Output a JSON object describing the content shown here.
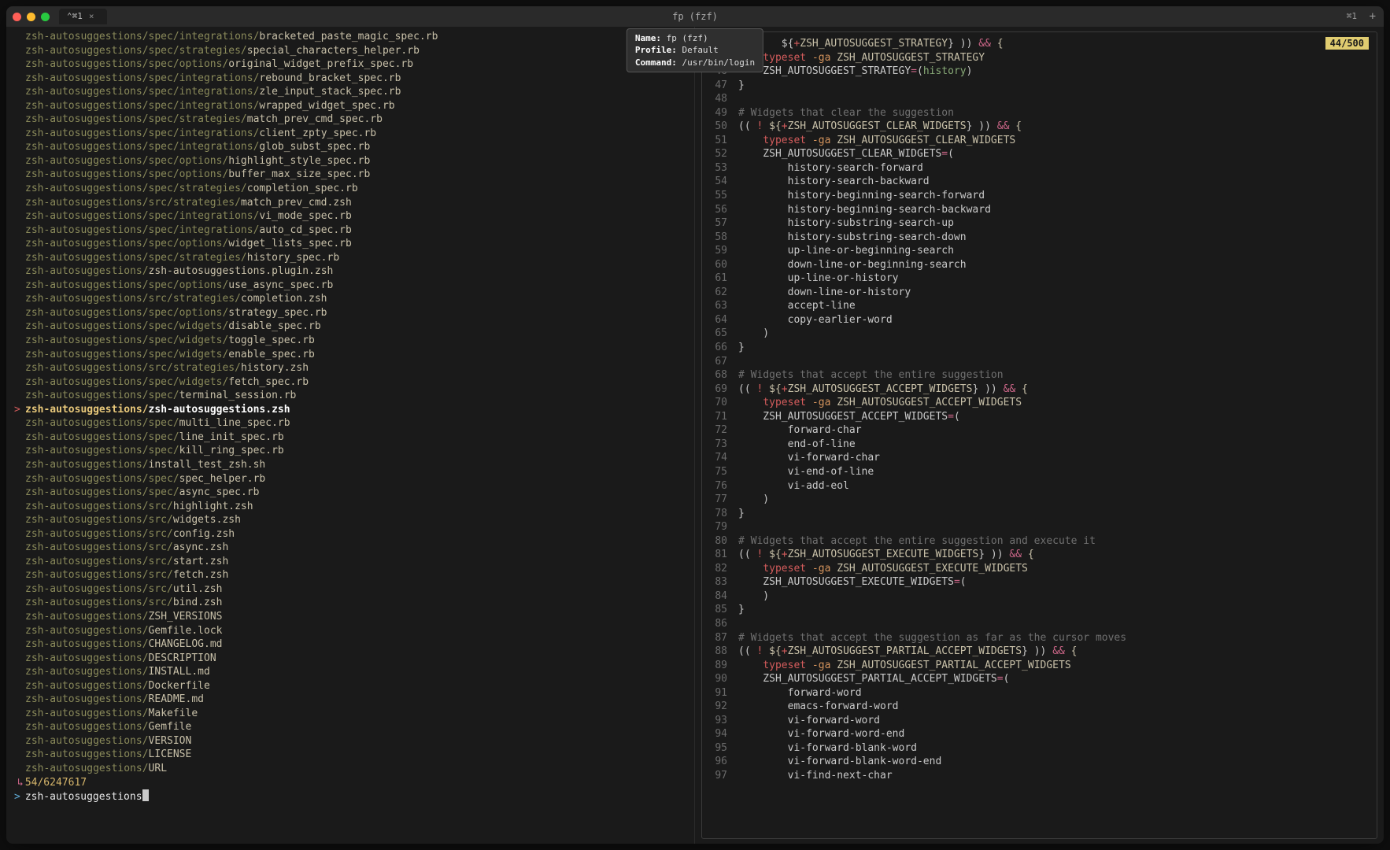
{
  "titlebar": {
    "tab_label": "⌃⌘1",
    "center_title": "fp (fzf)",
    "right_shortcut": "⌘1"
  },
  "tooltip": {
    "name_label": "Name:",
    "name_value": "fp (fzf)",
    "profile_label": "Profile:",
    "profile_value": "Default",
    "command_label": "Command:",
    "command_value": "/usr/bin/login"
  },
  "left_pane": {
    "files": [
      {
        "dir": "zsh-autosuggestions/spec/integrations/",
        "file": "bracketed_paste_magic_spec.rb"
      },
      {
        "dir": "zsh-autosuggestions/spec/strategies/",
        "file": "special_characters_helper.rb"
      },
      {
        "dir": "zsh-autosuggestions/spec/options/",
        "file": "original_widget_prefix_spec.rb"
      },
      {
        "dir": "zsh-autosuggestions/spec/integrations/",
        "file": "rebound_bracket_spec.rb"
      },
      {
        "dir": "zsh-autosuggestions/spec/integrations/",
        "file": "zle_input_stack_spec.rb"
      },
      {
        "dir": "zsh-autosuggestions/spec/integrations/",
        "file": "wrapped_widget_spec.rb"
      },
      {
        "dir": "zsh-autosuggestions/spec/strategies/",
        "file": "match_prev_cmd_spec.rb"
      },
      {
        "dir": "zsh-autosuggestions/spec/integrations/",
        "file": "client_zpty_spec.rb"
      },
      {
        "dir": "zsh-autosuggestions/spec/integrations/",
        "file": "glob_subst_spec.rb"
      },
      {
        "dir": "zsh-autosuggestions/spec/options/",
        "file": "highlight_style_spec.rb"
      },
      {
        "dir": "zsh-autosuggestions/spec/options/",
        "file": "buffer_max_size_spec.rb"
      },
      {
        "dir": "zsh-autosuggestions/spec/strategies/",
        "file": "completion_spec.rb"
      },
      {
        "dir": "zsh-autosuggestions/src/strategies/",
        "file": "match_prev_cmd.zsh"
      },
      {
        "dir": "zsh-autosuggestions/spec/integrations/",
        "file": "vi_mode_spec.rb"
      },
      {
        "dir": "zsh-autosuggestions/spec/integrations/",
        "file": "auto_cd_spec.rb"
      },
      {
        "dir": "zsh-autosuggestions/spec/options/",
        "file": "widget_lists_spec.rb"
      },
      {
        "dir": "zsh-autosuggestions/spec/strategies/",
        "file": "history_spec.rb"
      },
      {
        "dir": "zsh-autosuggestions/",
        "file": "zsh-autosuggestions.plugin.zsh"
      },
      {
        "dir": "zsh-autosuggestions/spec/options/",
        "file": "use_async_spec.rb"
      },
      {
        "dir": "zsh-autosuggestions/src/strategies/",
        "file": "completion.zsh"
      },
      {
        "dir": "zsh-autosuggestions/spec/options/",
        "file": "strategy_spec.rb"
      },
      {
        "dir": "zsh-autosuggestions/spec/widgets/",
        "file": "disable_spec.rb"
      },
      {
        "dir": "zsh-autosuggestions/spec/widgets/",
        "file": "toggle_spec.rb"
      },
      {
        "dir": "zsh-autosuggestions/spec/widgets/",
        "file": "enable_spec.rb"
      },
      {
        "dir": "zsh-autosuggestions/src/strategies/",
        "file": "history.zsh"
      },
      {
        "dir": "zsh-autosuggestions/spec/widgets/",
        "file": "fetch_spec.rb"
      },
      {
        "dir": "zsh-autosuggestions/spec/",
        "file": "terminal_session.rb"
      },
      {
        "dir": "zsh-autosuggestions/",
        "file": "zsh-autosuggestions.zsh",
        "selected": true
      },
      {
        "dir": "zsh-autosuggestions/spec/",
        "file": "multi_line_spec.rb"
      },
      {
        "dir": "zsh-autosuggestions/spec/",
        "file": "line_init_spec.rb"
      },
      {
        "dir": "zsh-autosuggestions/spec/",
        "file": "kill_ring_spec.rb"
      },
      {
        "dir": "zsh-autosuggestions/",
        "file": "install_test_zsh.sh"
      },
      {
        "dir": "zsh-autosuggestions/spec/",
        "file": "spec_helper.rb"
      },
      {
        "dir": "zsh-autosuggestions/spec/",
        "file": "async_spec.rb"
      },
      {
        "dir": "zsh-autosuggestions/src/",
        "file": "highlight.zsh"
      },
      {
        "dir": "zsh-autosuggestions/src/",
        "file": "widgets.zsh"
      },
      {
        "dir": "zsh-autosuggestions/src/",
        "file": "config.zsh"
      },
      {
        "dir": "zsh-autosuggestions/src/",
        "file": "async.zsh"
      },
      {
        "dir": "zsh-autosuggestions/src/",
        "file": "start.zsh"
      },
      {
        "dir": "zsh-autosuggestions/src/",
        "file": "fetch.zsh"
      },
      {
        "dir": "zsh-autosuggestions/src/",
        "file": "util.zsh"
      },
      {
        "dir": "zsh-autosuggestions/src/",
        "file": "bind.zsh"
      },
      {
        "dir": "zsh-autosuggestions/",
        "file": "ZSH_VERSIONS"
      },
      {
        "dir": "zsh-autosuggestions/",
        "file": "Gemfile.lock"
      },
      {
        "dir": "zsh-autosuggestions/",
        "file": "CHANGELOG.md"
      },
      {
        "dir": "zsh-autosuggestions/",
        "file": "DESCRIPTION"
      },
      {
        "dir": "zsh-autosuggestions/",
        "file": "INSTALL.md"
      },
      {
        "dir": "zsh-autosuggestions/",
        "file": "Dockerfile"
      },
      {
        "dir": "zsh-autosuggestions/",
        "file": "README.md"
      },
      {
        "dir": "zsh-autosuggestions/",
        "file": "Makefile"
      },
      {
        "dir": "zsh-autosuggestions/",
        "file": "Gemfile"
      },
      {
        "dir": "zsh-autosuggestions/",
        "file": "VERSION"
      },
      {
        "dir": "zsh-autosuggestions/",
        "file": "LICENSE"
      },
      {
        "dir": "zsh-autosuggestions/",
        "file": "URL"
      }
    ],
    "stats": "54/6247617",
    "query": "zsh-autosuggestions"
  },
  "right_pane": {
    "badge": "44/500",
    "code": [
      {
        "n": "",
        "segs": [
          [
            "",
            "       ${"
          ],
          [
            "plus",
            "+"
          ],
          [
            "var",
            "ZSH_AUTOSUGGEST_STRATEGY"
          ],
          [
            "",
            "} )) "
          ],
          [
            "op",
            "&&"
          ],
          [
            "var",
            " {"
          ]
        ]
      },
      {
        "n": 45,
        "segs": [
          [
            "",
            "    "
          ],
          [
            "kw",
            "typeset"
          ],
          [
            "str",
            " -ga"
          ],
          [
            "var",
            " ZSH_AUTOSUGGEST_STRATEGY"
          ]
        ]
      },
      {
        "n": 46,
        "segs": [
          [
            "",
            "    ZSH_AUTOSUGGEST_STRATEGY"
          ],
          [
            "op",
            "="
          ],
          [
            "",
            "("
          ],
          [
            "fn",
            "history"
          ],
          [
            "",
            ")"
          ]
        ]
      },
      {
        "n": 47,
        "segs": [
          [
            "",
            "}"
          ]
        ]
      },
      {
        "n": 48,
        "segs": [
          [
            "",
            " "
          ]
        ]
      },
      {
        "n": 49,
        "segs": [
          [
            "comment",
            "# Widgets that clear the suggestion"
          ]
        ]
      },
      {
        "n": 50,
        "segs": [
          [
            "",
            "(( "
          ],
          [
            "kw",
            "!"
          ],
          [
            "var",
            " ${"
          ],
          [
            "plus",
            "+"
          ],
          [
            "var",
            "ZSH_AUTOSUGGEST_CLEAR_WIDGETS"
          ],
          [
            "",
            "} )) "
          ],
          [
            "op",
            "&&"
          ],
          [
            "var",
            " {"
          ]
        ]
      },
      {
        "n": 51,
        "segs": [
          [
            "",
            "    "
          ],
          [
            "kw",
            "typeset"
          ],
          [
            "str",
            " -ga"
          ],
          [
            "var",
            " ZSH_AUTOSUGGEST_CLEAR_WIDGETS"
          ]
        ]
      },
      {
        "n": 52,
        "segs": [
          [
            "",
            "    ZSH_AUTOSUGGEST_CLEAR_WIDGETS"
          ],
          [
            "op",
            "="
          ],
          [
            "",
            "("
          ]
        ]
      },
      {
        "n": 53,
        "segs": [
          [
            "",
            "        history-search-forward"
          ]
        ]
      },
      {
        "n": 54,
        "segs": [
          [
            "",
            "        history-search-backward"
          ]
        ]
      },
      {
        "n": 55,
        "segs": [
          [
            "",
            "        history-beginning-search-forward"
          ]
        ]
      },
      {
        "n": 56,
        "segs": [
          [
            "",
            "        history-beginning-search-backward"
          ]
        ]
      },
      {
        "n": 57,
        "segs": [
          [
            "",
            "        history-substring-search-up"
          ]
        ]
      },
      {
        "n": 58,
        "segs": [
          [
            "",
            "        history-substring-search-down"
          ]
        ]
      },
      {
        "n": 59,
        "segs": [
          [
            "",
            "        up-line-or-beginning-search"
          ]
        ]
      },
      {
        "n": 60,
        "segs": [
          [
            "",
            "        down-line-or-beginning-search"
          ]
        ]
      },
      {
        "n": 61,
        "segs": [
          [
            "",
            "        up-line-or-history"
          ]
        ]
      },
      {
        "n": 62,
        "segs": [
          [
            "",
            "        down-line-or-history"
          ]
        ]
      },
      {
        "n": 63,
        "segs": [
          [
            "",
            "        accept-line"
          ]
        ]
      },
      {
        "n": 64,
        "segs": [
          [
            "",
            "        copy-earlier-word"
          ]
        ]
      },
      {
        "n": 65,
        "segs": [
          [
            "",
            "    )"
          ]
        ]
      },
      {
        "n": 66,
        "segs": [
          [
            "",
            "}"
          ]
        ]
      },
      {
        "n": 67,
        "segs": [
          [
            "",
            " "
          ]
        ]
      },
      {
        "n": 68,
        "segs": [
          [
            "comment",
            "# Widgets that accept the entire suggestion"
          ]
        ]
      },
      {
        "n": 69,
        "segs": [
          [
            "",
            "(( "
          ],
          [
            "kw",
            "!"
          ],
          [
            "var",
            " ${"
          ],
          [
            "plus",
            "+"
          ],
          [
            "var",
            "ZSH_AUTOSUGGEST_ACCEPT_WIDGETS"
          ],
          [
            "",
            "} )) "
          ],
          [
            "op",
            "&&"
          ],
          [
            "var",
            " {"
          ]
        ]
      },
      {
        "n": 70,
        "segs": [
          [
            "",
            "    "
          ],
          [
            "kw",
            "typeset"
          ],
          [
            "str",
            " -ga"
          ],
          [
            "var",
            " ZSH_AUTOSUGGEST_ACCEPT_WIDGETS"
          ]
        ]
      },
      {
        "n": 71,
        "segs": [
          [
            "",
            "    ZSH_AUTOSUGGEST_ACCEPT_WIDGETS"
          ],
          [
            "op",
            "="
          ],
          [
            "",
            "("
          ]
        ]
      },
      {
        "n": 72,
        "segs": [
          [
            "",
            "        forward-char"
          ]
        ]
      },
      {
        "n": 73,
        "segs": [
          [
            "",
            "        end-of-line"
          ]
        ]
      },
      {
        "n": 74,
        "segs": [
          [
            "",
            "        vi-forward-char"
          ]
        ]
      },
      {
        "n": 75,
        "segs": [
          [
            "",
            "        vi-end-of-line"
          ]
        ]
      },
      {
        "n": 76,
        "segs": [
          [
            "",
            "        vi-add-eol"
          ]
        ]
      },
      {
        "n": 77,
        "segs": [
          [
            "",
            "    )"
          ]
        ]
      },
      {
        "n": 78,
        "segs": [
          [
            "",
            "}"
          ]
        ]
      },
      {
        "n": 79,
        "segs": [
          [
            "",
            " "
          ]
        ]
      },
      {
        "n": 80,
        "segs": [
          [
            "comment",
            "# Widgets that accept the entire suggestion and execute it"
          ]
        ]
      },
      {
        "n": 81,
        "segs": [
          [
            "",
            "(( "
          ],
          [
            "kw",
            "!"
          ],
          [
            "var",
            " ${"
          ],
          [
            "plus",
            "+"
          ],
          [
            "var",
            "ZSH_AUTOSUGGEST_EXECUTE_WIDGETS"
          ],
          [
            "",
            "} )) "
          ],
          [
            "op",
            "&&"
          ],
          [
            "var",
            " {"
          ]
        ]
      },
      {
        "n": 82,
        "segs": [
          [
            "",
            "    "
          ],
          [
            "kw",
            "typeset"
          ],
          [
            "str",
            " -ga"
          ],
          [
            "var",
            " ZSH_AUTOSUGGEST_EXECUTE_WIDGETS"
          ]
        ]
      },
      {
        "n": 83,
        "segs": [
          [
            "",
            "    ZSH_AUTOSUGGEST_EXECUTE_WIDGETS"
          ],
          [
            "op",
            "="
          ],
          [
            "",
            "("
          ]
        ]
      },
      {
        "n": 84,
        "segs": [
          [
            "",
            "    )"
          ]
        ]
      },
      {
        "n": 85,
        "segs": [
          [
            "",
            "}"
          ]
        ]
      },
      {
        "n": 86,
        "segs": [
          [
            "",
            " "
          ]
        ]
      },
      {
        "n": 87,
        "segs": [
          [
            "comment",
            "# Widgets that accept the suggestion as far as the cursor moves"
          ]
        ]
      },
      {
        "n": 88,
        "segs": [
          [
            "",
            "(( "
          ],
          [
            "kw",
            "!"
          ],
          [
            "var",
            " ${"
          ],
          [
            "plus",
            "+"
          ],
          [
            "var",
            "ZSH_AUTOSUGGEST_PARTIAL_ACCEPT_WIDGETS"
          ],
          [
            "",
            "} )) "
          ],
          [
            "op",
            "&&"
          ],
          [
            "var",
            " {"
          ]
        ]
      },
      {
        "n": 89,
        "segs": [
          [
            "",
            "    "
          ],
          [
            "kw",
            "typeset"
          ],
          [
            "str",
            " -ga"
          ],
          [
            "var",
            " ZSH_AUTOSUGGEST_PARTIAL_ACCEPT_WIDGETS"
          ]
        ]
      },
      {
        "n": 90,
        "segs": [
          [
            "",
            "    ZSH_AUTOSUGGEST_PARTIAL_ACCEPT_WIDGETS"
          ],
          [
            "op",
            "="
          ],
          [
            "",
            "("
          ]
        ]
      },
      {
        "n": 91,
        "segs": [
          [
            "",
            "        forward-word"
          ]
        ]
      },
      {
        "n": 92,
        "segs": [
          [
            "",
            "        emacs-forward-word"
          ]
        ]
      },
      {
        "n": 93,
        "segs": [
          [
            "",
            "        vi-forward-word"
          ]
        ]
      },
      {
        "n": 94,
        "segs": [
          [
            "",
            "        vi-forward-word-end"
          ]
        ]
      },
      {
        "n": 95,
        "segs": [
          [
            "",
            "        vi-forward-blank-word"
          ]
        ]
      },
      {
        "n": 96,
        "segs": [
          [
            "",
            "        vi-forward-blank-word-end"
          ]
        ]
      },
      {
        "n": 97,
        "segs": [
          [
            "",
            "        vi-find-next-char"
          ]
        ]
      }
    ]
  }
}
